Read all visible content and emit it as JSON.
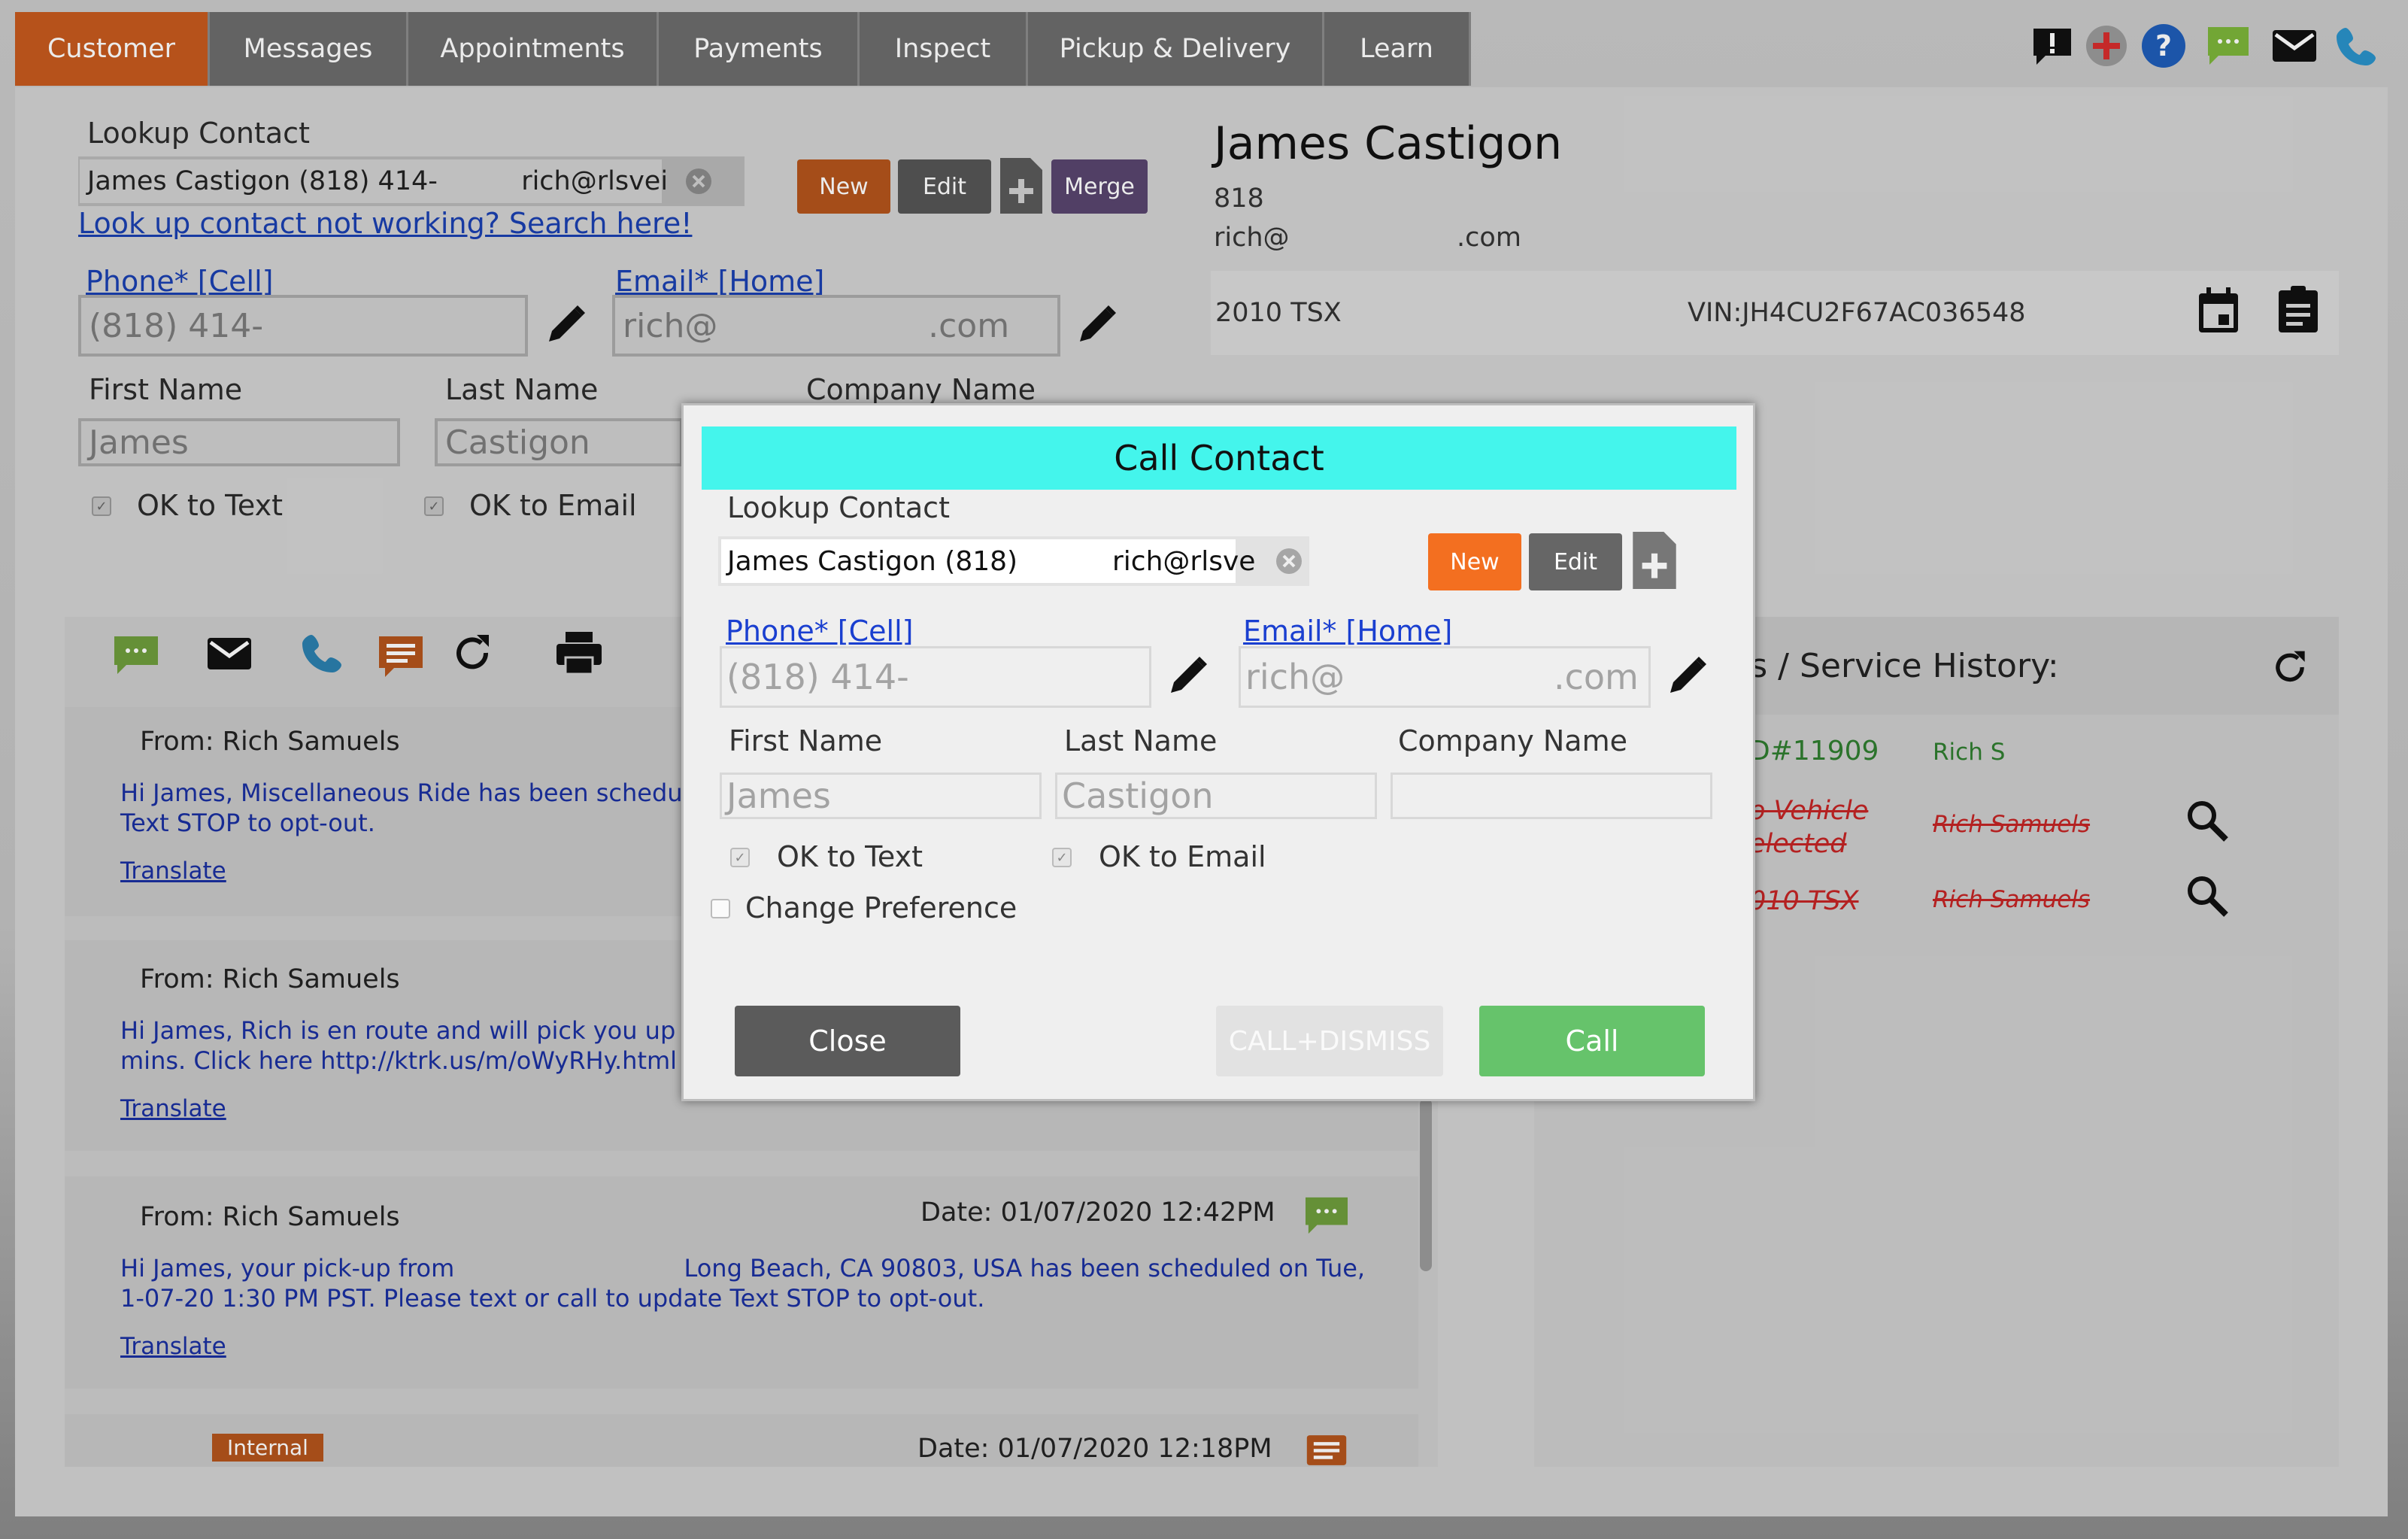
{
  "tabs": [
    "Customer",
    "Messages",
    "Appointments",
    "Payments",
    "Inspect",
    "Pickup & Delivery",
    "Learn"
  ],
  "toolbar_icons": [
    "alert-icon",
    "add-icon",
    "help-icon",
    "chat-icon",
    "mail-icon",
    "phone-icon"
  ],
  "lookup": {
    "label": "Lookup Contact",
    "value": "James Castigon (818) 414-          rich@rlsvei",
    "help_link": "Look up contact not working? Search here!",
    "new_label": "New",
    "edit_label": "Edit",
    "merge_label": "Merge"
  },
  "contact_form": {
    "phone_label": "Phone* [Cell]",
    "phone_value": "(818) 414-",
    "email_label": "Email* [Home]",
    "email_value": "rich@                    .com",
    "first_name_label": "First Name",
    "first_name_value": "James",
    "last_name_label": "Last Name",
    "last_name_value": "Castigon",
    "company_label": "Company Name",
    "ok_text": "OK to Text",
    "ok_email": "OK to Email"
  },
  "customer_card": {
    "name": "James Castigon",
    "phone": "818",
    "email": "rich@                    .com",
    "vehicle": "2010 TSX",
    "vin": "VIN:JH4CU2F67AC036548"
  },
  "history": {
    "title": "ts / Service History:",
    "rows": [
      {
        "id": "D#11909",
        "name": "Rich S"
      },
      {
        "id": "o Vehicle elected",
        "name": "Rich Samuels"
      },
      {
        "id": "010 TSX",
        "name": "Rich Samuels"
      }
    ]
  },
  "messages": [
    {
      "from": "From: Rich Samuels",
      "date": "",
      "text1": "Hi James, Miscellaneous Ride has been scheduled",
      "text2": "Text STOP to opt-out.",
      "translate": "Translate"
    },
    {
      "from": "From: Rich Samuels",
      "date": "",
      "text1": "Hi James, Rich is en route and will pick you up at",
      "text2": "mins. Click here http://ktrk.us/m/oWyRHy.html to t",
      "translate": "Translate"
    },
    {
      "from": "From: Rich Samuels",
      "date": "Date: 01/07/2020 12:42PM",
      "text1": "Hi James, your pick-up from                              Long Beach, CA 90803, USA has been scheduled on Tue,",
      "text2": "1-07-20 1:30 PM PST. Please text or call to update Text STOP to opt-out.",
      "translate": "Translate"
    },
    {
      "from": "",
      "date": "Date: 01/07/2020 12:18PM",
      "text1": "",
      "text2": "",
      "translate": "",
      "badge": "Internal"
    }
  ],
  "modal": {
    "title": "Call Contact",
    "lookup_label": "Lookup Contact",
    "lookup_value": "James Castigon (818)           rich@rlsve",
    "new_label": "New",
    "edit_label": "Edit",
    "phone_label": "Phone* [Cell]",
    "phone_value": "(818) 414-",
    "email_label": "Email* [Home]",
    "email_value": "rich@                   .com",
    "first_name_label": "First Name",
    "first_name_value": "James",
    "last_name_label": "Last Name",
    "last_name_value": "Castigon",
    "company_label": "Company Name",
    "company_value": "",
    "ok_text": "OK to Text",
    "ok_email": "OK to Email",
    "change_pref": "Change Preference",
    "close_label": "Close",
    "call_dismiss_label": "CALL+DISMISS",
    "call_label": "Call"
  },
  "colors": {
    "accent": "#c65a1e",
    "modal_header": "#44f5ec",
    "call_green": "#66c36b",
    "merge_purple": "#6b4f87"
  }
}
